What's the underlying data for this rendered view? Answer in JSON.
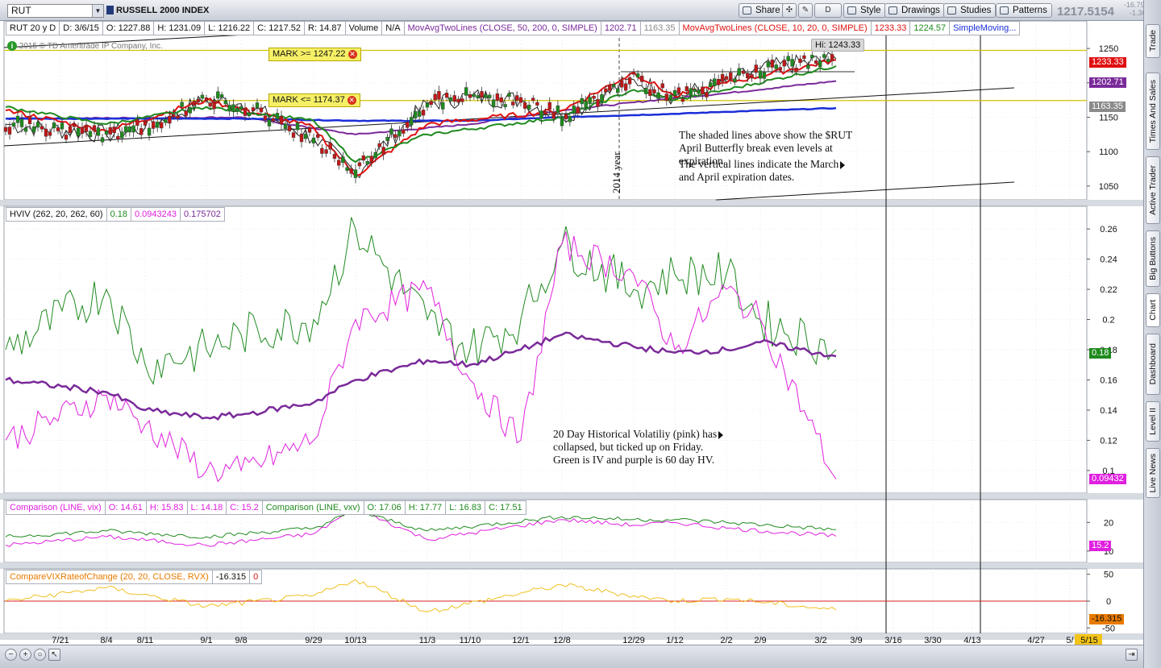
{
  "toolbar": {
    "symbol": "RUT",
    "index_name": "RUSSELL 2000 INDEX",
    "buttons": {
      "share": "Share",
      "style": "Style",
      "drawings": "Drawings",
      "studies": "Studies",
      "patterns": "Patterns",
      "d_label": "D"
    },
    "last_price": "1217.5154",
    "change": "-16.7979",
    "change_pct": "-1.36%"
  },
  "side_tabs": [
    "Trade",
    "Times And Sales",
    "Active Trader",
    "Big Buttons",
    "Chart",
    "Dashboard",
    "Level II",
    "Live News"
  ],
  "price_panel": {
    "legend": [
      "RUT 20 y D",
      "D: 3/6/15",
      "O: 1227.88",
      "H: 1231.09",
      "L: 1216.22",
      "C: 1217.52",
      "R: 14.87",
      "Volume",
      "N/A",
      "MovAvgTwoLines (CLOSE, 50, 200, 0, SIMPLE)",
      "1202.71",
      "1163.35",
      "MovAvgTwoLines (CLOSE, 10, 20, 0, SIMPLE)",
      "1233.33",
      "1224.57",
      "SimpleMoving..."
    ],
    "copyright": "2015 © TD Ameritrade IP Company, Inc.",
    "hi_label": "Hi: 1243.33",
    "mark_upper": "MARK >= 1247.22",
    "mark_lower": "MARK <= 1174.37",
    "year_label": "2014 year",
    "y_ticks": [
      "1250",
      "1200",
      "1150",
      "1100",
      "1050"
    ],
    "badges": {
      "last": "1233.33",
      "ma50": "1202.71",
      "ma200": "1163.35"
    },
    "annotation_1": [
      "The shaded lines above show the $RUT",
      "April Butterfly break even levels at",
      "expiration."
    ],
    "annotation_2": [
      "The vertical lines indicate the March",
      "and April expiration dates."
    ]
  },
  "hviv_panel": {
    "legend": [
      "HVIV (262, 20, 262, 60)",
      "0.18",
      "0.0943243",
      "0.175702"
    ],
    "y_ticks": [
      "0.26",
      "0.24",
      "0.22",
      "0.2",
      "0.18",
      "0.16",
      "0.14",
      "0.12",
      "0.1"
    ],
    "badges": {
      "iv": "0.18",
      "hv20": "0.09432"
    },
    "annotation": [
      "20 Day Historical Volatiliy (pink) has",
      "collapsed, but ticked up on Friday.",
      "Green is IV and purple is 60 day HV."
    ]
  },
  "comparison_panel": {
    "legend": [
      "Comparison (LINE, vix)",
      "O: 14.61",
      "H: 15.83",
      "L: 14.18",
      "C: 15.2",
      "Comparison (LINE, vxv)",
      "O: 17.06",
      "H: 17.77",
      "L: 16.83",
      "C: 17.51"
    ],
    "y_ticks": [
      "20",
      "10"
    ],
    "badge": "15.2"
  },
  "roc_panel": {
    "legend": [
      "CompareVIXRateofChange (20, 20, CLOSE, RVX)",
      "-16.315",
      "0"
    ],
    "y_ticks": [
      "50",
      "0",
      "-50"
    ],
    "badge": "-16.315"
  },
  "x_axis": {
    "labels": [
      "7/21",
      "8/4",
      "8/11",
      "9/1",
      "9/8",
      "9/29",
      "10/13",
      "11/3",
      "11/10",
      "12/1",
      "12/8",
      "12/29",
      "1/12",
      "2/2",
      "2/9",
      "3/2",
      "3/9",
      "3/16",
      "3/30",
      "4/13",
      "4/27",
      "5/",
      "5/15"
    ]
  },
  "colors": {
    "green": "#1f8a1f",
    "pink": "#e020e0",
    "purple": "#7a2a9a",
    "red": "#e01010",
    "blue": "#1a2ed8",
    "orange": "#e87a00",
    "yellow": "#f0c020",
    "gray": "#8a8a8a"
  },
  "chart_data": [
    {
      "type": "line",
      "title": "RUSSELL 2000 INDEX",
      "series": [
        {
          "name": "RUT",
          "x": [
            "7/21",
            "8/4",
            "8/11",
            "9/1",
            "9/8",
            "9/29",
            "10/13",
            "11/3",
            "11/10",
            "12/1",
            "12/8",
            "12/29",
            "1/12",
            "2/2",
            "2/9",
            "3/2"
          ],
          "values": [
            1140,
            1125,
            1135,
            1175,
            1170,
            1120,
            1070,
            1170,
            1180,
            1175,
            1150,
            1205,
            1180,
            1200,
            1220,
            1235
          ]
        },
        {
          "name": "MovAvgTwoLines 50",
          "x": [
            "7/21",
            "9/8",
            "10/13",
            "11/10",
            "12/8",
            "1/12",
            "2/2",
            "3/2"
          ],
          "values": [
            1148,
            1150,
            1125,
            1140,
            1160,
            1178,
            1185,
            1202.71
          ]
        },
        {
          "name": "MovAvgTwoLines 200",
          "x": [
            "7/21",
            "9/8",
            "10/13",
            "11/10",
            "12/8",
            "1/12",
            "2/2",
            "3/2"
          ],
          "values": [
            1148,
            1148,
            1145,
            1145,
            1150,
            1155,
            1158,
            1163.35
          ]
        },
        {
          "name": "MovAvgTwoLines 10",
          "x": [
            "7/21",
            "8/4",
            "9/1",
            "9/29",
            "10/13",
            "11/3",
            "12/8",
            "12/29",
            "1/12",
            "2/2",
            "3/2"
          ],
          "values": [
            1160,
            1130,
            1175,
            1135,
            1065,
            1140,
            1160,
            1215,
            1180,
            1200,
            1233.33
          ]
        },
        {
          "name": "MovAvgTwoLines 20",
          "x": [
            "7/21",
            "8/4",
            "9/1",
            "9/29",
            "10/13",
            "11/3",
            "12/8",
            "12/29",
            "1/12",
            "2/2",
            "3/2"
          ],
          "values": [
            1165,
            1140,
            1165,
            1145,
            1085,
            1125,
            1150,
            1190,
            1175,
            1190,
            1224.57
          ]
        }
      ],
      "marks": [
        1247.22,
        1174.37
      ],
      "ylim": [
        1030,
        1290
      ]
    },
    {
      "type": "line",
      "title": "HVIV (262, 20, 262, 60)",
      "series": [
        {
          "name": "IV",
          "x": [
            "7/21",
            "8/4",
            "8/11",
            "9/1",
            "9/8",
            "9/29",
            "10/13",
            "11/3",
            "11/10",
            "12/1",
            "12/8",
            "12/29",
            "1/12",
            "2/2",
            "2/9",
            "3/2"
          ],
          "values": [
            0.18,
            0.22,
            0.17,
            0.18,
            0.19,
            0.2,
            0.26,
            0.2,
            0.18,
            0.2,
            0.25,
            0.22,
            0.23,
            0.23,
            0.2,
            0.18
          ]
        },
        {
          "name": "20 day HV",
          "x": [
            "7/21",
            "8/4",
            "8/11",
            "9/1",
            "9/8",
            "9/29",
            "10/13",
            "11/3",
            "11/10",
            "12/1",
            "12/8",
            "12/29",
            "1/12",
            "2/2",
            "2/9",
            "3/2"
          ],
          "values": [
            0.12,
            0.15,
            0.13,
            0.1,
            0.1,
            0.12,
            0.2,
            0.22,
            0.16,
            0.12,
            0.25,
            0.23,
            0.18,
            0.22,
            0.2,
            0.0943
          ]
        },
        {
          "name": "60 day HV",
          "x": [
            "7/21",
            "8/4",
            "8/11",
            "9/1",
            "9/8",
            "9/29",
            "10/13",
            "11/3",
            "11/10",
            "12/1",
            "12/8",
            "12/29",
            "1/12",
            "2/2",
            "2/9",
            "3/2"
          ],
          "values": [
            0.16,
            0.152,
            0.14,
            0.135,
            0.137,
            0.145,
            0.16,
            0.173,
            0.17,
            0.18,
            0.19,
            0.182,
            0.178,
            0.18,
            0.185,
            0.1757
          ]
        }
      ],
      "ylim": [
        0.085,
        0.275
      ]
    },
    {
      "type": "line",
      "title": "Comparison",
      "series": [
        {
          "name": "vix",
          "x": [
            "7/21",
            "8/4",
            "9/1",
            "9/29",
            "10/13",
            "11/3",
            "12/8",
            "12/29",
            "1/12",
            "2/2",
            "3/2"
          ],
          "values": [
            12,
            15,
            12,
            16,
            25,
            14,
            21,
            19,
            20,
            18,
            15.2
          ]
        },
        {
          "name": "vxv",
          "x": [
            "7/21",
            "8/4",
            "9/1",
            "9/29",
            "10/13",
            "11/3",
            "12/8",
            "12/29",
            "1/12",
            "2/2",
            "3/2"
          ],
          "values": [
            15,
            17,
            15,
            18,
            24,
            17,
            22,
            21,
            21,
            20,
            17.51
          ]
        }
      ],
      "ylim": [
        6,
        28
      ]
    },
    {
      "type": "line",
      "title": "CompareVIXRateofChange (20, 20, CLOSE, RVX)",
      "series": [
        {
          "name": "RVX rate of change",
          "x": [
            "7/21",
            "8/4",
            "9/1",
            "9/29",
            "10/13",
            "11/3",
            "12/8",
            "12/29",
            "1/12",
            "2/2",
            "3/2"
          ],
          "values": [
            0,
            25,
            -10,
            10,
            40,
            -20,
            30,
            10,
            0,
            5,
            -16.315
          ]
        }
      ],
      "ylim": [
        -60,
        60
      ]
    }
  ]
}
